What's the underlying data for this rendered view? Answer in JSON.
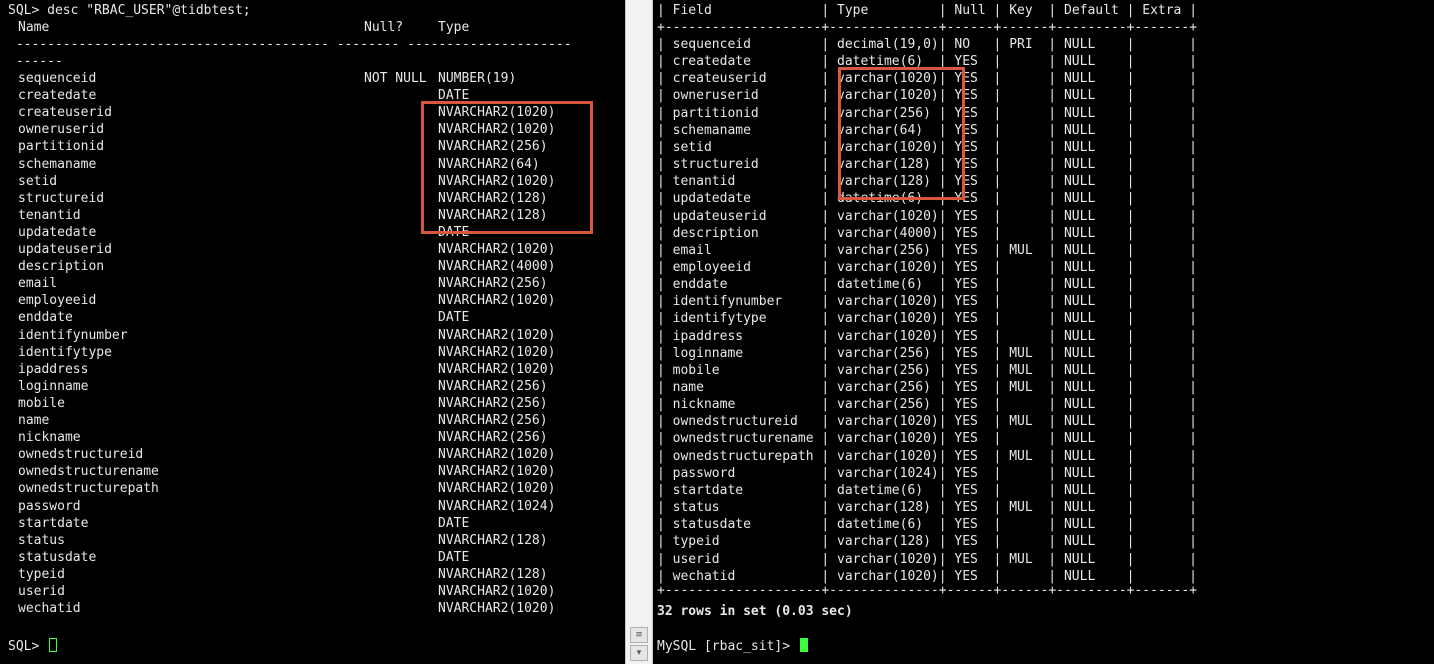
{
  "left_terminal": {
    "command_line": "SQL> desc \"RBAC_USER\"@tidbtest;",
    "headers": {
      "name": "Name",
      "null": "Null?",
      "type": "Type"
    },
    "separator": " ---------------------------------------- -------- ---------------------",
    "separator_wrap": " ------",
    "rows": [
      {
        "name": "sequenceid",
        "null": "NOT NULL",
        "type": "NUMBER(19)"
      },
      {
        "name": "createdate",
        "null": "",
        "type": "DATE"
      },
      {
        "name": "createuserid",
        "null": "",
        "type": "NVARCHAR2(1020)"
      },
      {
        "name": "owneruserid",
        "null": "",
        "type": "NVARCHAR2(1020)"
      },
      {
        "name": "partitionid",
        "null": "",
        "type": "NVARCHAR2(256)"
      },
      {
        "name": "schemaname",
        "null": "",
        "type": "NVARCHAR2(64)"
      },
      {
        "name": "setid",
        "null": "",
        "type": "NVARCHAR2(1020)"
      },
      {
        "name": "structureid",
        "null": "",
        "type": "NVARCHAR2(128)"
      },
      {
        "name": "tenantid",
        "null": "",
        "type": "NVARCHAR2(128)"
      },
      {
        "name": "updatedate",
        "null": "",
        "type": "DATE"
      },
      {
        "name": "updateuserid",
        "null": "",
        "type": "NVARCHAR2(1020)"
      },
      {
        "name": "description",
        "null": "",
        "type": "NVARCHAR2(4000)"
      },
      {
        "name": "email",
        "null": "",
        "type": "NVARCHAR2(256)"
      },
      {
        "name": "employeeid",
        "null": "",
        "type": "NVARCHAR2(1020)"
      },
      {
        "name": "enddate",
        "null": "",
        "type": "DATE"
      },
      {
        "name": "identifynumber",
        "null": "",
        "type": "NVARCHAR2(1020)"
      },
      {
        "name": "identifytype",
        "null": "",
        "type": "NVARCHAR2(1020)"
      },
      {
        "name": "ipaddress",
        "null": "",
        "type": "NVARCHAR2(1020)"
      },
      {
        "name": "loginname",
        "null": "",
        "type": "NVARCHAR2(256)"
      },
      {
        "name": "mobile",
        "null": "",
        "type": "NVARCHAR2(256)"
      },
      {
        "name": "name",
        "null": "",
        "type": "NVARCHAR2(256)"
      },
      {
        "name": "nickname",
        "null": "",
        "type": "NVARCHAR2(256)"
      },
      {
        "name": "ownedstructureid",
        "null": "",
        "type": "NVARCHAR2(1020)"
      },
      {
        "name": "ownedstructurename",
        "null": "",
        "type": "NVARCHAR2(1020)"
      },
      {
        "name": "ownedstructurepath",
        "null": "",
        "type": "NVARCHAR2(1020)"
      },
      {
        "name": "password",
        "null": "",
        "type": "NVARCHAR2(1024)"
      },
      {
        "name": "startdate",
        "null": "",
        "type": "DATE"
      },
      {
        "name": "status",
        "null": "",
        "type": "NVARCHAR2(128)"
      },
      {
        "name": "statusdate",
        "null": "",
        "type": "DATE"
      },
      {
        "name": "typeid",
        "null": "",
        "type": "NVARCHAR2(128)"
      },
      {
        "name": "userid",
        "null": "",
        "type": "NVARCHAR2(1020)"
      },
      {
        "name": "wechatid",
        "null": "",
        "type": "NVARCHAR2(1020)"
      }
    ],
    "prompt": "SQL> "
  },
  "right_terminal": {
    "border_line": "+--------------------+--------------+------+------+---------+-------+",
    "header_line": "| Field              | Type         | Null | Key  | Default | Extra |",
    "rows": [
      {
        "field": "sequenceid",
        "type": "decimal(19,0)",
        "null": "NO",
        "key": "PRI",
        "default": "NULL",
        "extra": ""
      },
      {
        "field": "createdate",
        "type": "datetime(6)",
        "null": "YES",
        "key": "",
        "default": "NULL",
        "extra": ""
      },
      {
        "field": "createuserid",
        "type": "varchar(1020)",
        "null": "YES",
        "key": "",
        "default": "NULL",
        "extra": ""
      },
      {
        "field": "owneruserid",
        "type": "varchar(1020)",
        "null": "YES",
        "key": "",
        "default": "NULL",
        "extra": ""
      },
      {
        "field": "partitionid",
        "type": "varchar(256)",
        "null": "YES",
        "key": "",
        "default": "NULL",
        "extra": ""
      },
      {
        "field": "schemaname",
        "type": "varchar(64)",
        "null": "YES",
        "key": "",
        "default": "NULL",
        "extra": ""
      },
      {
        "field": "setid",
        "type": "varchar(1020)",
        "null": "YES",
        "key": "",
        "default": "NULL",
        "extra": ""
      },
      {
        "field": "structureid",
        "type": "varchar(128)",
        "null": "YES",
        "key": "",
        "default": "NULL",
        "extra": ""
      },
      {
        "field": "tenantid",
        "type": "varchar(128)",
        "null": "YES",
        "key": "",
        "default": "NULL",
        "extra": ""
      },
      {
        "field": "updatedate",
        "type": "datetime(6)",
        "null": "YES",
        "key": "",
        "default": "NULL",
        "extra": ""
      },
      {
        "field": "updateuserid",
        "type": "varchar(1020)",
        "null": "YES",
        "key": "",
        "default": "NULL",
        "extra": ""
      },
      {
        "field": "description",
        "type": "varchar(4000)",
        "null": "YES",
        "key": "",
        "default": "NULL",
        "extra": ""
      },
      {
        "field": "email",
        "type": "varchar(256)",
        "null": "YES",
        "key": "MUL",
        "default": "NULL",
        "extra": ""
      },
      {
        "field": "employeeid",
        "type": "varchar(1020)",
        "null": "YES",
        "key": "",
        "default": "NULL",
        "extra": ""
      },
      {
        "field": "enddate",
        "type": "datetime(6)",
        "null": "YES",
        "key": "",
        "default": "NULL",
        "extra": ""
      },
      {
        "field": "identifynumber",
        "type": "varchar(1020)",
        "null": "YES",
        "key": "",
        "default": "NULL",
        "extra": ""
      },
      {
        "field": "identifytype",
        "type": "varchar(1020)",
        "null": "YES",
        "key": "",
        "default": "NULL",
        "extra": ""
      },
      {
        "field": "ipaddress",
        "type": "varchar(1020)",
        "null": "YES",
        "key": "",
        "default": "NULL",
        "extra": ""
      },
      {
        "field": "loginname",
        "type": "varchar(256)",
        "null": "YES",
        "key": "MUL",
        "default": "NULL",
        "extra": ""
      },
      {
        "field": "mobile",
        "type": "varchar(256)",
        "null": "YES",
        "key": "MUL",
        "default": "NULL",
        "extra": ""
      },
      {
        "field": "name",
        "type": "varchar(256)",
        "null": "YES",
        "key": "MUL",
        "default": "NULL",
        "extra": ""
      },
      {
        "field": "nickname",
        "type": "varchar(256)",
        "null": "YES",
        "key": "",
        "default": "NULL",
        "extra": ""
      },
      {
        "field": "ownedstructureid",
        "type": "varchar(1020)",
        "null": "YES",
        "key": "MUL",
        "default": "NULL",
        "extra": ""
      },
      {
        "field": "ownedstructurename",
        "type": "varchar(1020)",
        "null": "YES",
        "key": "",
        "default": "NULL",
        "extra": ""
      },
      {
        "field": "ownedstructurepath",
        "type": "varchar(1020)",
        "null": "YES",
        "key": "MUL",
        "default": "NULL",
        "extra": ""
      },
      {
        "field": "password",
        "type": "varchar(1024)",
        "null": "YES",
        "key": "",
        "default": "NULL",
        "extra": ""
      },
      {
        "field": "startdate",
        "type": "datetime(6)",
        "null": "YES",
        "key": "",
        "default": "NULL",
        "extra": ""
      },
      {
        "field": "status",
        "type": "varchar(128)",
        "null": "YES",
        "key": "MUL",
        "default": "NULL",
        "extra": ""
      },
      {
        "field": "statusdate",
        "type": "datetime(6)",
        "null": "YES",
        "key": "",
        "default": "NULL",
        "extra": ""
      },
      {
        "field": "typeid",
        "type": "varchar(128)",
        "null": "YES",
        "key": "",
        "default": "NULL",
        "extra": ""
      },
      {
        "field": "userid",
        "type": "varchar(1020)",
        "null": "YES",
        "key": "MUL",
        "default": "NULL",
        "extra": ""
      },
      {
        "field": "wechatid",
        "type": "varchar(1020)",
        "null": "YES",
        "key": "",
        "default": "NULL",
        "extra": ""
      }
    ],
    "summary": "32 rows in set (0.03 sec)",
    "prompt": "MySQL [rbac_sit]> "
  },
  "splitter": {
    "up_icon": "scroll-up-icon",
    "down_icon": "scroll-down-icon"
  },
  "colors": {
    "terminal_bg": "#000000",
    "terminal_fg": "#e8e8e8",
    "highlight": "#d9573f",
    "cursor": "#3cff3c"
  }
}
